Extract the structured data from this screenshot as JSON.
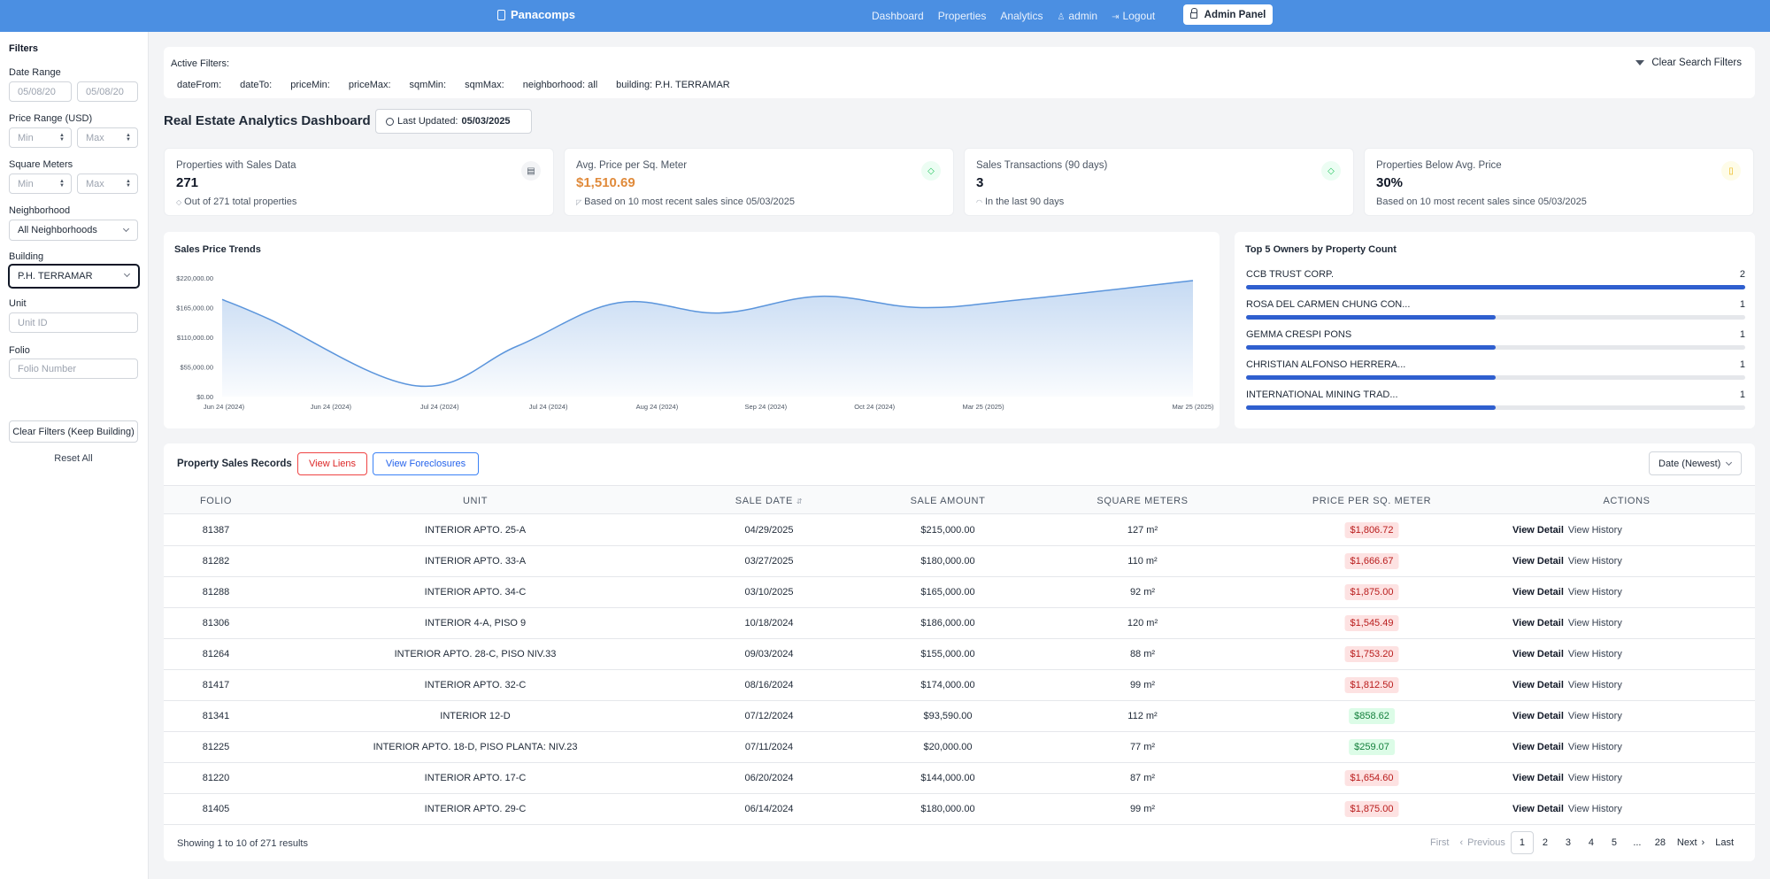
{
  "nav": {
    "brand": "Panacomps",
    "links": [
      "Dashboard",
      "Properties",
      "Analytics"
    ],
    "user": "admin",
    "logout": "Logout",
    "admin_panel": "Admin Panel"
  },
  "sidebar": {
    "title": "Filters",
    "date_range": {
      "label": "Date Range",
      "from_value": "05/08/20",
      "to_value": "05/08/20"
    },
    "price_range": {
      "label": "Price Range (USD)",
      "min_placeholder": "Min",
      "max_placeholder": "Max"
    },
    "square_meters": {
      "label": "Square Meters",
      "min_placeholder": "Min",
      "max_placeholder": "Max"
    },
    "neighborhood": {
      "label": "Neighborhood",
      "value": "All Neighborhoods"
    },
    "building": {
      "label": "Building",
      "value": "P.H. TERRAMAR"
    },
    "unit": {
      "label": "Unit",
      "placeholder": "Unit ID"
    },
    "folio": {
      "label": "Folio",
      "placeholder": "Folio Number"
    },
    "clear_button": "Clear Filters (Keep Building)",
    "reset": "Reset All"
  },
  "active_filters": {
    "title": "Active Filters:",
    "chips": [
      "dateFrom:",
      "dateTo:",
      "priceMin:",
      "priceMax:",
      "sqmMin:",
      "sqmMax:",
      "neighborhood: all",
      "building: P.H. TERRAMAR"
    ],
    "clear": "Clear Search Filters"
  },
  "header": {
    "title": "Real Estate Analytics Dashboard",
    "updated_label": "Last Updated:",
    "updated_value": "05/03/2025"
  },
  "stats": [
    {
      "label": "Properties with Sales Data",
      "value": "271",
      "sub": "Out of 271 total properties",
      "icon": "list-icon",
      "accent": "#4b5563"
    },
    {
      "label": "Avg. Price per Sq. Meter",
      "value": "$1,510.69",
      "sub": "Based on 10 most recent sales since 05/03/2025",
      "icon": "tag-icon",
      "accent": "#22c55e"
    },
    {
      "label": "Sales Transactions (90 days)",
      "value": "3",
      "sub": "In the last 90 days",
      "icon": "tag-icon",
      "accent": "#22c55e"
    },
    {
      "label": "Properties Below Avg. Price",
      "value": "30%",
      "sub": "Based on 10 most recent sales since 05/03/2025",
      "icon": "document-icon",
      "accent": "#eab308"
    }
  ],
  "chart_data": {
    "type": "area",
    "title": "Sales Price Trends",
    "categories": [
      "Jun 24 (2024)",
      "Jun 24 (2024)",
      "Jul 24 (2024)",
      "Jul 24 (2024)",
      "Aug 24 (2024)",
      "Sep 24 (2024)",
      "Oct 24 (2024)",
      "Mar 25 (2025)",
      "Mar 25 (2025)"
    ],
    "series": [
      {
        "values": [
          180000,
          144000,
          20000,
          93590,
          174000,
          155000,
          186000,
          165000,
          180000,
          215000
        ]
      }
    ],
    "x_positions": [
      0,
      0.048,
      0.2,
      0.304,
      0.408,
      0.512,
      0.616,
      0.72,
      0.824,
      1.0
    ],
    "tick_positions": [
      0,
      0.112,
      0.224,
      0.336,
      0.448,
      0.56,
      0.672,
      0.784,
      1.0
    ],
    "yticks": [
      "$0.00",
      "$55,000.00",
      "$110,000.00",
      "$165,000.00",
      "$220,000.00"
    ],
    "ylim": [
      0,
      220000
    ],
    "grid": false,
    "color": "#5b95dc"
  },
  "owners": {
    "title": "Top 5 Owners by Property Count",
    "items": [
      {
        "name": "CCB TRUST CORP.",
        "count": "2",
        "fraction": 1.0
      },
      {
        "name": "ROSA DEL CARMEN CHUNG CON...",
        "count": "1",
        "fraction": 0.5
      },
      {
        "name": "GEMMA CRESPI PONS",
        "count": "1",
        "fraction": 0.5
      },
      {
        "name": "CHRISTIAN ALFONSO HERRERA...",
        "count": "1",
        "fraction": 0.5
      },
      {
        "name": "INTERNATIONAL MINING TRAD...",
        "count": "1",
        "fraction": 0.5
      }
    ]
  },
  "records": {
    "title": "Property Sales Records",
    "view_liens": "View Liens",
    "view_foreclosures": "View Foreclosures",
    "sort": "Date (Newest)",
    "columns": [
      "FOLIO",
      "UNIT",
      "SALE DATE",
      "SALE AMOUNT",
      "SQUARE METERS",
      "PRICE PER SQ. METER",
      "ACTIONS"
    ],
    "action_detail": "View Detail",
    "action_history": "View History",
    "rows": [
      {
        "folio": "81387",
        "unit": "INTERIOR APTO. 25-A",
        "date": "04/29/2025",
        "amount": "$215,000.00",
        "sqm": "127 m²",
        "ppsm": "$1,806.72",
        "level": "high"
      },
      {
        "folio": "81282",
        "unit": "INTERIOR APTO. 33-A",
        "date": "03/27/2025",
        "amount": "$180,000.00",
        "sqm": "110 m²",
        "ppsm": "$1,666.67",
        "level": "high"
      },
      {
        "folio": "81288",
        "unit": "INTERIOR APTO. 34-C",
        "date": "03/10/2025",
        "amount": "$165,000.00",
        "sqm": "92 m²",
        "ppsm": "$1,875.00",
        "level": "high"
      },
      {
        "folio": "81306",
        "unit": "INTERIOR 4-A, PISO 9",
        "date": "10/18/2024",
        "amount": "$186,000.00",
        "sqm": "120 m²",
        "ppsm": "$1,545.49",
        "level": "high"
      },
      {
        "folio": "81264",
        "unit": "INTERIOR APTO. 28-C, PISO NIV.33",
        "date": "09/03/2024",
        "amount": "$155,000.00",
        "sqm": "88 m²",
        "ppsm": "$1,753.20",
        "level": "high"
      },
      {
        "folio": "81417",
        "unit": "INTERIOR APTO. 32-C",
        "date": "08/16/2024",
        "amount": "$174,000.00",
        "sqm": "99 m²",
        "ppsm": "$1,812.50",
        "level": "high"
      },
      {
        "folio": "81341",
        "unit": "INTERIOR 12-D",
        "date": "07/12/2024",
        "amount": "$93,590.00",
        "sqm": "112 m²",
        "ppsm": "$858.62",
        "level": "low"
      },
      {
        "folio": "81225",
        "unit": "INTERIOR APTO. 18-D, PISO PLANTA: NIV.23",
        "date": "07/11/2024",
        "amount": "$20,000.00",
        "sqm": "77 m²",
        "ppsm": "$259.07",
        "level": "low"
      },
      {
        "folio": "81220",
        "unit": "INTERIOR APTO. 17-C",
        "date": "06/20/2024",
        "amount": "$144,000.00",
        "sqm": "87 m²",
        "ppsm": "$1,654.60",
        "level": "high"
      },
      {
        "folio": "81405",
        "unit": "INTERIOR APTO. 29-C",
        "date": "06/14/2024",
        "amount": "$180,000.00",
        "sqm": "99 m²",
        "ppsm": "$1,875.00",
        "level": "high"
      }
    ],
    "showing": "Showing 1 to 10 of 271 results",
    "pager": {
      "first": "First",
      "previous": "Previous",
      "pages": [
        "1",
        "2",
        "3",
        "4",
        "5",
        "...",
        "28"
      ],
      "next": "Next",
      "last": "Last",
      "current": "1"
    }
  }
}
